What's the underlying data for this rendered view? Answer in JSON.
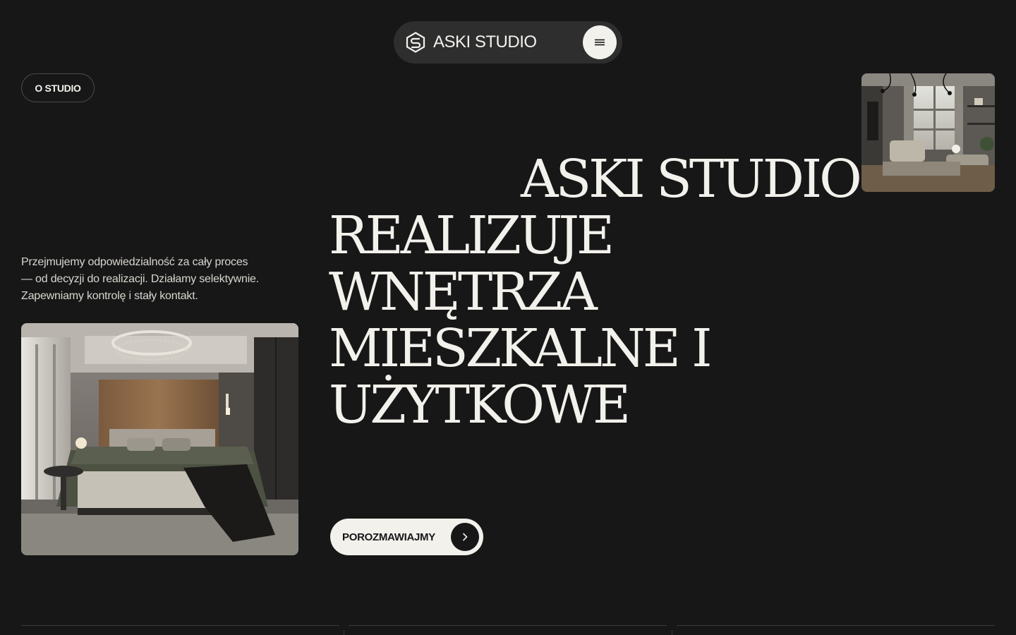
{
  "nav": {
    "brand": "ASKI STUDIO",
    "logo_icon": "aski-logo-mark",
    "menu_icon": "hamburger-menu-icon"
  },
  "chip": {
    "label": "O STUDIO"
  },
  "intro": {
    "line1": "Przejmujemy odpowiedzialność za cały proces",
    "line2": "— od decyzji do realizacji. Działamy selektywnie.",
    "line3": "Zapewniamy kontrolę i stały kontakt."
  },
  "headline": {
    "line1": "ASKI STUDIO",
    "line2": "REALIZUJE WNĘTRZA",
    "line3": "MIESZKALNE I",
    "line4": "UŻYTKOWE"
  },
  "cta": {
    "label": "POROZMAWIAJMY",
    "icon": "chevron-right-icon"
  },
  "colors": {
    "background": "#171717",
    "pill": "#2e2e2e",
    "light": "#f3f1ec"
  }
}
